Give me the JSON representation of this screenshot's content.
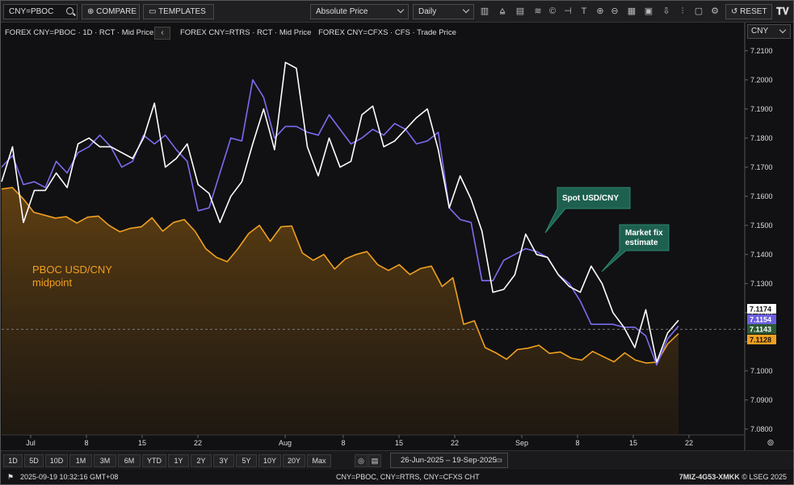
{
  "toolbar": {
    "ric": "CNY=PBOC",
    "compare": "COMPARE",
    "templates": "TEMPLATES",
    "price_type": "Absolute Price",
    "interval": "Daily",
    "reset": "RESET"
  },
  "legend": {
    "series1": "FOREX CNY=PBOC · 1D · RCT · Mid Price",
    "series2": "FOREX CNY=RTRS · RCT · Mid Price",
    "series3": "FOREX CNY=CFXS · CFS · Trade Price"
  },
  "currency": "CNY",
  "ranges": [
    "1D",
    "5D",
    "10D",
    "1M",
    "3M",
    "6M",
    "YTD",
    "1Y",
    "2Y",
    "3Y",
    "5Y",
    "10Y",
    "20Y",
    "Max"
  ],
  "date_range": "26-Jun-2025  –  19-Sep-2025",
  "status": {
    "timestamp": "2025-09-19 10:32:16 GMT+08",
    "rics": "CNY=PBOC, CNY=RTRS, CNY=CFXS CHT",
    "code": "7MIZ-4G53-XMKK",
    "copyright": "© LSEG 2025"
  },
  "chart_data": {
    "type": "line",
    "ylim": [
      7.078,
      7.213
    ],
    "yticks": [
      "7.2100",
      "7.2000",
      "7.1900",
      "7.1800",
      "7.1700",
      "7.1600",
      "7.1500",
      "7.1400",
      "7.1300",
      "7.1200",
      "7.1100",
      "7.1000",
      "7.0900",
      "7.0800"
    ],
    "xticks": [
      "Jul",
      "8",
      "15",
      "22",
      "Aug",
      "8",
      "15",
      "22",
      "Sep",
      "8",
      "15",
      "22"
    ],
    "annotations": [
      "PBOC USD/CNY midpoint",
      "Spot USD/CNY",
      "Market fix estimate"
    ],
    "last_values": {
      "spot": "7.1174",
      "estimate": "7.1154",
      "pboc": "7.1128",
      "other": "7.1143"
    },
    "colors": {
      "pboc": "#f0a020",
      "spot": "#ffffff",
      "estimate": "#7b6cf0"
    },
    "series": [
      {
        "name": "PBOC USD/CNY midpoint",
        "color": "#f0a020",
        "values": [
          7.1625,
          7.163,
          7.1592,
          7.1545,
          7.1535,
          7.1525,
          7.153,
          7.1508,
          7.1528,
          7.1532,
          7.15,
          7.1478,
          7.149,
          7.1495,
          7.1526,
          7.148,
          7.151,
          7.152,
          7.148,
          7.142,
          7.139,
          7.1375,
          7.142,
          7.1472,
          7.15,
          7.1445,
          7.1495,
          7.1498,
          7.1405,
          7.138,
          7.14,
          7.135,
          7.1385,
          7.14,
          7.141,
          7.1365,
          7.1345,
          7.1365,
          7.1331,
          7.1352,
          7.136,
          7.129,
          7.132,
          7.116,
          7.1172,
          7.108,
          7.1062,
          7.104,
          7.1073,
          7.1078,
          7.1088,
          7.106,
          7.1065,
          7.1044,
          7.1037,
          7.1067,
          7.1049,
          7.1031,
          7.1062,
          7.1037,
          7.1027,
          7.103,
          7.1093,
          7.1128
        ]
      },
      {
        "name": "Market fix estimate",
        "color": "#7b6cf0",
        "values": [
          7.17,
          7.174,
          7.164,
          7.165,
          7.163,
          7.172,
          7.168,
          7.175,
          7.177,
          7.181,
          7.177,
          7.17,
          7.172,
          7.181,
          7.178,
          7.181,
          7.176,
          7.172,
          7.155,
          7.156,
          7.168,
          7.18,
          7.179,
          7.2,
          7.194,
          7.18,
          7.184,
          7.184,
          7.182,
          7.181,
          7.188,
          7.183,
          7.178,
          7.18,
          7.183,
          7.181,
          7.185,
          7.183,
          7.178,
          7.179,
          7.182,
          7.156,
          7.152,
          7.151,
          7.131,
          7.131,
          7.138,
          7.14,
          7.142,
          7.141,
          7.139,
          7.133,
          7.13,
          7.124,
          7.116,
          7.116,
          7.116,
          7.115,
          7.115,
          7.112,
          7.102,
          7.111,
          7.1154
        ]
      },
      {
        "name": "Spot USD/CNY",
        "color": "#ffffff",
        "values": [
          7.165,
          7.177,
          7.151,
          7.162,
          7.162,
          7.168,
          7.163,
          7.178,
          7.18,
          7.177,
          7.177,
          7.175,
          7.173,
          7.18,
          7.192,
          7.17,
          7.173,
          7.178,
          7.164,
          7.161,
          7.151,
          7.16,
          7.165,
          7.178,
          7.19,
          7.176,
          7.206,
          7.204,
          7.177,
          7.167,
          7.18,
          7.17,
          7.172,
          7.188,
          7.191,
          7.177,
          7.179,
          7.183,
          7.187,
          7.19,
          7.176,
          7.156,
          7.167,
          7.159,
          7.148,
          7.127,
          7.128,
          7.133,
          7.147,
          7.14,
          7.139,
          7.133,
          7.129,
          7.127,
          7.136,
          7.13,
          7.12,
          7.115,
          7.108,
          7.121,
          7.103,
          7.113,
          7.1174
        ]
      }
    ]
  }
}
